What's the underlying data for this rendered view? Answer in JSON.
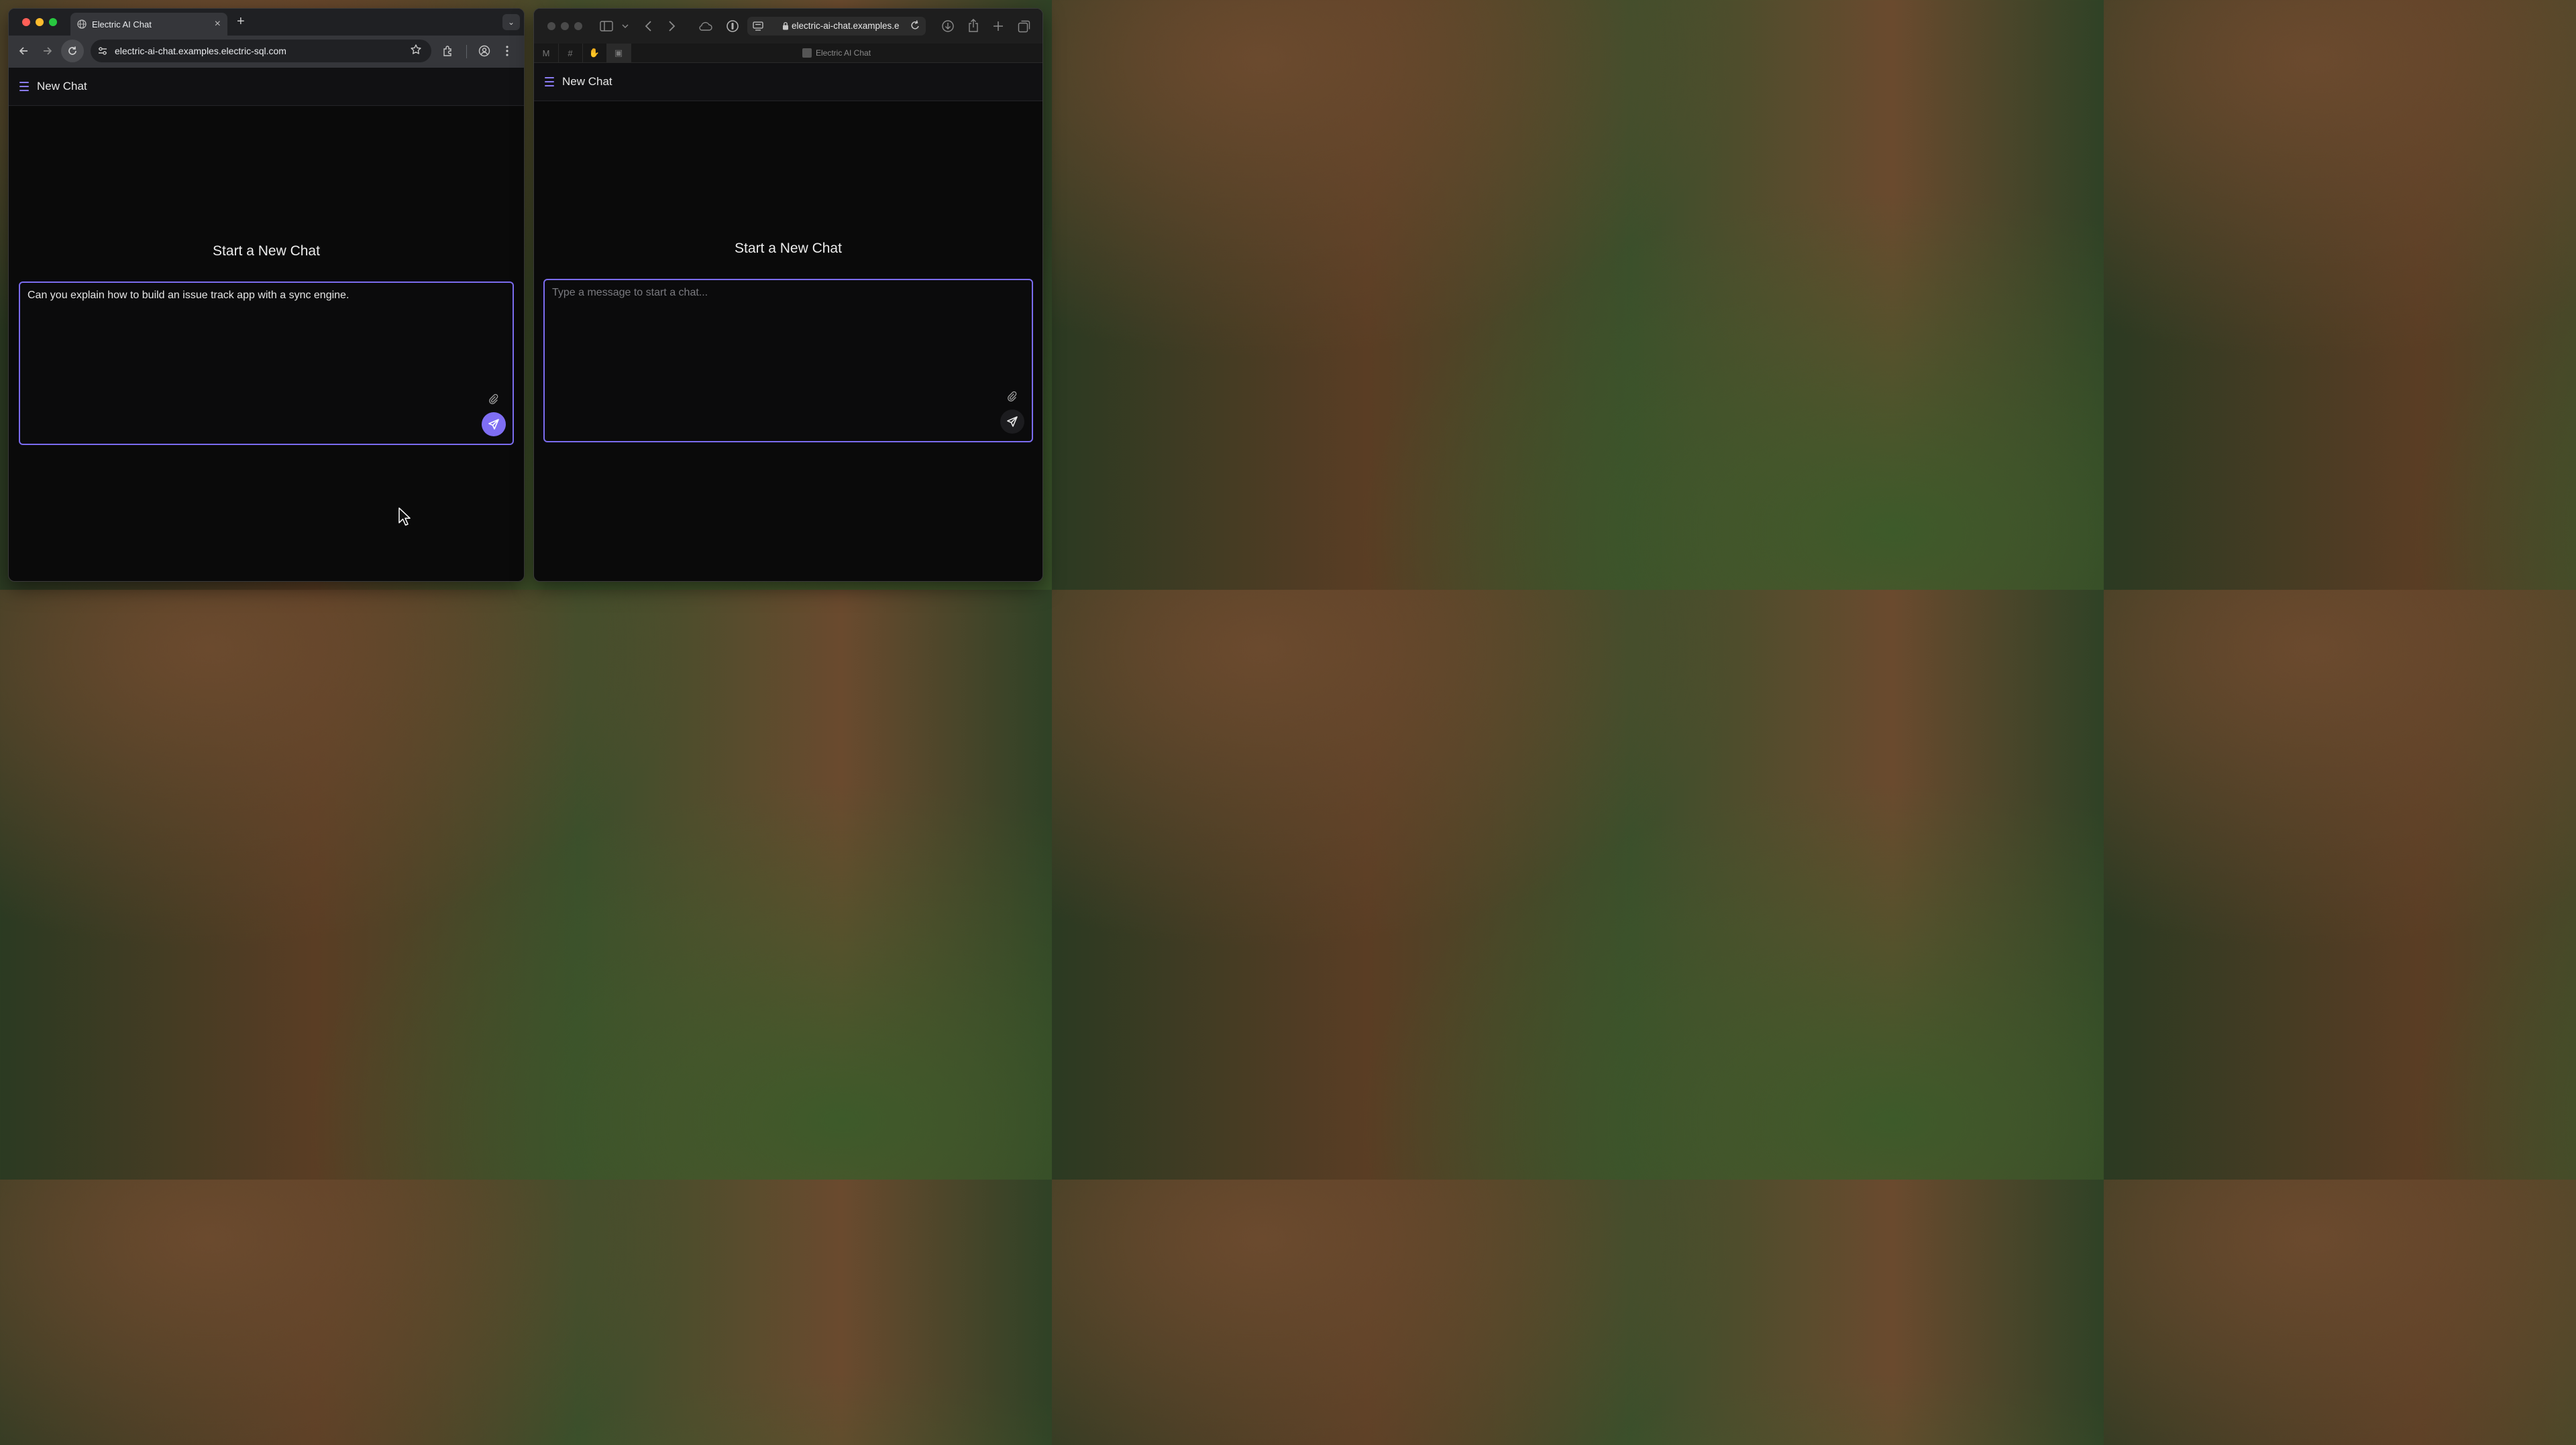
{
  "chrome": {
    "tab_title": "Electric AI Chat",
    "tab_close": "×",
    "new_tab": "+",
    "tab_list": "⌄",
    "url": "electric-ai-chat.examples.electric-sql.com",
    "app": {
      "header_title": "New Chat",
      "start_title": "Start a New Chat",
      "message_value": "Can you explain how to build an issue track app with a sync engine."
    }
  },
  "safari": {
    "url": "electric-ai-chat.examples.e",
    "tab_title": "Electric AI Chat",
    "pinned_tabs": [
      "M",
      "#",
      "✋",
      "▣"
    ],
    "app": {
      "header_title": "New Chat",
      "start_title": "Start a New Chat",
      "message_placeholder": "Type a message to start a chat..."
    }
  },
  "colors": {
    "accent": "#7b6cf0",
    "send_active": "#7f6ef3",
    "app_bg": "#0a0a0a"
  },
  "icons": {
    "menu": "hamburger-icon",
    "attach": "paperclip-icon",
    "send": "paper-plane-icon"
  }
}
